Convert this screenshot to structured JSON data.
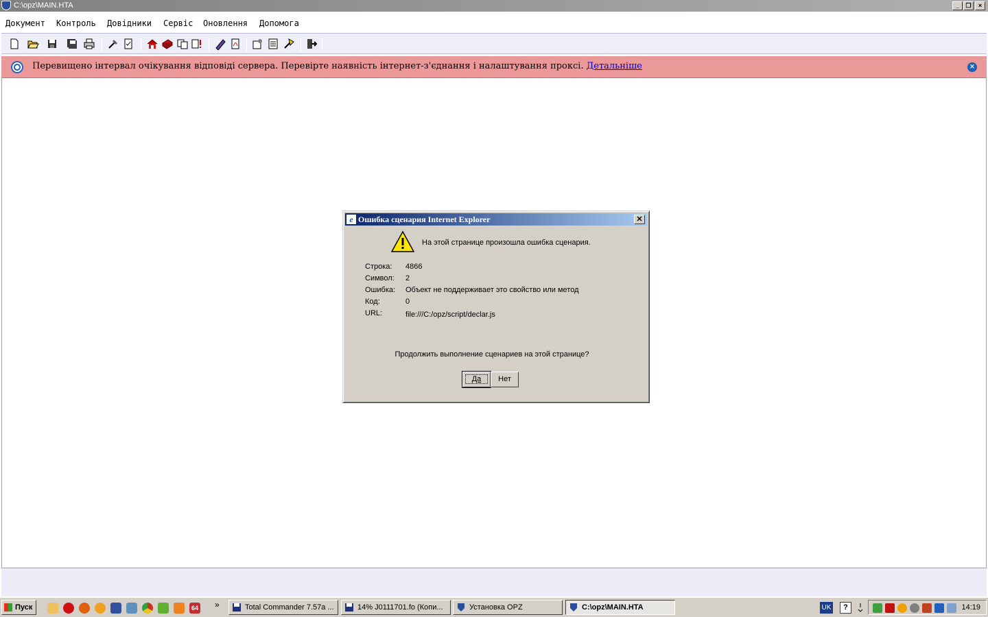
{
  "window": {
    "title": "C:\\opz\\MAIN.HTA",
    "minimize": "_",
    "restore": "❐",
    "close": "×"
  },
  "menu": [
    "Документ",
    "Контроль",
    "Довідники",
    "Сервіс",
    "Оновлення",
    "Допомога"
  ],
  "toolbar": [
    "new-document-icon",
    "open-folder-icon",
    "save-icon",
    "save-all-icon",
    "print-icon",
    "tools-icon",
    "check-document-icon",
    "home-icon",
    "book-icon",
    "copy-documents-icon",
    "document-alert-icon",
    "help-pen-icon",
    "pdf-document-icon",
    "settings-document-icon",
    "list-document-icon",
    "wizard-icon",
    "exit-icon"
  ],
  "banner": {
    "message": "Перевищено інтервал очікування відповіді сервера. Перевірте наявність інтернет-з'єднання і налаштування проксі.",
    "link": "Детальніше",
    "close": "×",
    "color": "#eb9898"
  },
  "dialog": {
    "title": "Ошибка сценария Internet Explorer",
    "close": "✕",
    "message": "На этой странице произошла ошибка сценария.",
    "details": [
      {
        "label": "Строка:",
        "value": "4866"
      },
      {
        "label": "Символ:",
        "value": "2"
      },
      {
        "label": "Ошибка:",
        "value": "Объект не поддерживает это свойство или метод"
      },
      {
        "label": "Код:",
        "value": "0"
      },
      {
        "label": "URL:",
        "value": "file:///C:/opz/script/declar.js"
      }
    ],
    "question": "Продолжить выполнение сценариев на этой странице?",
    "yes_label": "Да",
    "no_label": "Нет"
  },
  "taskbar": {
    "start_label": "Пуск",
    "quicklaunch_more": "»",
    "quicklaunch_badge": "64",
    "tasks": [
      {
        "label": "Total Commander 7.57a ..."
      },
      {
        "label": "14% J0111701.fo (Копи..."
      },
      {
        "label": "Установка OPZ"
      },
      {
        "label": "C:\\opz\\MAIN.HTA",
        "active": true
      }
    ],
    "lang": "UK",
    "help": "?",
    "clock": "14:19"
  }
}
